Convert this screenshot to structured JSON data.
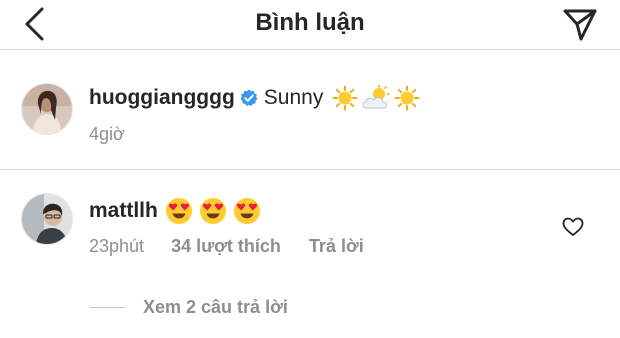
{
  "header": {
    "title": "Bình luận",
    "back_icon": "chevron-left-icon",
    "send_icon": "paper-plane-icon"
  },
  "caption": {
    "username": "huoggiangggg",
    "verified": true,
    "text": "Sunny",
    "emojis": [
      "sun",
      "sun-behind-cloud",
      "sun"
    ],
    "time": "4giờ"
  },
  "comment": {
    "username": "mattllh",
    "emojis": [
      "heart-eyes",
      "heart-eyes",
      "heart-eyes"
    ],
    "time": "23phút",
    "likes": "34 lượt thích",
    "reply_label": "Trả lời",
    "view_replies": "Xem 2 câu trả lời"
  },
  "colors": {
    "text": "#262626",
    "secondary": "#8e8e8e",
    "verified_blue": "#3897f0",
    "divider": "#dbdbdb"
  }
}
